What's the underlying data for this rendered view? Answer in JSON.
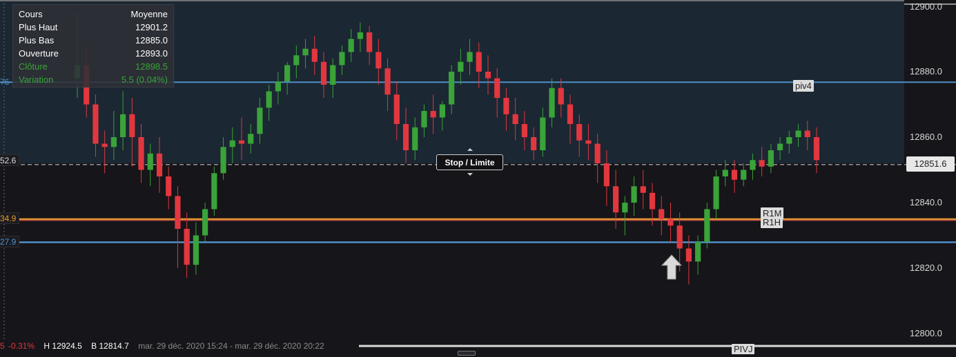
{
  "info_panel": {
    "header_left": "Cours",
    "header_right": "Moyenne",
    "rows": [
      {
        "label": "Plus Haut",
        "value": "12901.2"
      },
      {
        "label": "Plus Bas",
        "value": "12885.0"
      },
      {
        "label": "Ouverture",
        "value": "12893.0"
      },
      {
        "label": "Clôture",
        "value": "12898.5"
      },
      {
        "label": "Variation",
        "value": "5.5 (0.04%)"
      }
    ]
  },
  "left_tags": [
    {
      "text": "76",
      "color": "#4f90c8"
    },
    {
      "text": "52.6",
      "color": "#d8d8d8"
    },
    {
      "text": "34.9",
      "color": "#e49a2c"
    },
    {
      "text": "27.9",
      "color": "#4f90c8"
    }
  ],
  "price_axis": [
    "12900.0",
    "12880.0",
    "12860.0",
    "12851.6",
    "12840.0",
    "12820.0",
    "12800.0"
  ],
  "current_price": "12851.6",
  "levels": {
    "piv4": "piv4",
    "r1m": "R1M",
    "r1h": "R1H",
    "pivj": "PIVJ"
  },
  "stop_limit_label": "Stop / Limite",
  "bottom_bar": {
    "left_fragment": "5",
    "change": "-0.31%",
    "high": "H 12924.5",
    "low": "B 12814.7",
    "period": "mar. 29 déc. 2020 15:24 - mar. 29 déc. 2020 20:22"
  },
  "chart_data": {
    "type": "candlestick",
    "ylim": [
      12797,
      12902
    ],
    "y_ticks": [
      12800,
      12820,
      12840,
      12860,
      12880,
      12900
    ],
    "colors": {
      "up": "#3aa339",
      "down": "#e2373f",
      "background": "#161519",
      "zone": "#1b2733"
    },
    "horizontal_lines": [
      {
        "name": "piv4",
        "value": 12876.8,
        "color": "#4f90c8"
      },
      {
        "name": "current",
        "value": 12851.6,
        "color": "#d8d8d8"
      },
      {
        "name": "R1M",
        "value": 12834.9,
        "color": "#e49a2c"
      },
      {
        "name": "R1H",
        "value": 12834.6,
        "color": "#c0504d"
      },
      {
        "name": "pivot",
        "value": 12827.9,
        "color": "#4f90c8"
      }
    ],
    "candles": [
      [
        12878,
        12898,
        12882,
        12872
      ],
      [
        12882,
        12888,
        12870,
        12866
      ],
      [
        12870,
        12873,
        12858,
        12854
      ],
      [
        12858,
        12862,
        12857,
        12849
      ],
      [
        12857,
        12868,
        12860,
        12853
      ],
      [
        12860,
        12874,
        12867,
        12856
      ],
      [
        12867,
        12872,
        12860,
        12851
      ],
      [
        12860,
        12864,
        12850,
        12846
      ],
      [
        12850,
        12858,
        12855,
        12845
      ],
      [
        12855,
        12860,
        12848,
        12843
      ],
      [
        12848,
        12851,
        12842,
        12838
      ],
      [
        12842,
        12845,
        12832,
        12820
      ],
      [
        12832,
        12837,
        12821,
        12817
      ],
      [
        12821,
        12834,
        12830,
        12818
      ],
      [
        12830,
        12840,
        12838,
        12828
      ],
      [
        12838,
        12851,
        12849,
        12836
      ],
      [
        12849,
        12860,
        12857,
        12847
      ],
      [
        12857,
        12863,
        12859,
        12852
      ],
      [
        12859,
        12866,
        12858,
        12853
      ],
      [
        12858,
        12864,
        12861,
        12855
      ],
      [
        12861,
        12872,
        12869,
        12858
      ],
      [
        12869,
        12876,
        12874,
        12865
      ],
      [
        12874,
        12880,
        12877,
        12870
      ],
      [
        12877,
        12883,
        12882,
        12873
      ],
      [
        12882,
        12888,
        12885,
        12878
      ],
      [
        12885,
        12890,
        12887,
        12881
      ],
      [
        12887,
        12891,
        12883,
        12879
      ],
      [
        12883,
        12886,
        12876,
        12872
      ],
      [
        12876,
        12884,
        12882,
        12872
      ],
      [
        12882,
        12888,
        12886,
        12879
      ],
      [
        12886,
        12893,
        12890,
        12883
      ],
      [
        12890,
        12895,
        12892,
        12886
      ],
      [
        12892,
        12894,
        12886,
        12882
      ],
      [
        12886,
        12890,
        12881,
        12876
      ],
      [
        12881,
        12884,
        12873,
        12868
      ],
      [
        12873,
        12877,
        12864,
        12859
      ],
      [
        12864,
        12869,
        12856,
        12852
      ],
      [
        12856,
        12866,
        12863,
        12853
      ],
      [
        12863,
        12870,
        12868,
        12860
      ],
      [
        12868,
        12873,
        12866,
        12861
      ],
      [
        12866,
        12871,
        12870,
        12862
      ],
      [
        12870,
        12882,
        12880,
        12867
      ],
      [
        12880,
        12887,
        12883,
        12876
      ],
      [
        12883,
        12890,
        12886,
        12879
      ],
      [
        12886,
        12889,
        12880,
        12875
      ],
      [
        12880,
        12885,
        12878,
        12873
      ],
      [
        12878,
        12881,
        12872,
        12866
      ],
      [
        12872,
        12875,
        12867,
        12862
      ],
      [
        12867,
        12872,
        12864,
        12859
      ],
      [
        12864,
        12868,
        12860,
        12856
      ],
      [
        12860,
        12863,
        12856,
        12853
      ],
      [
        12856,
        12869,
        12866,
        12854
      ],
      [
        12866,
        12878,
        12875,
        12863
      ],
      [
        12875,
        12878,
        12870,
        12866
      ],
      [
        12870,
        12873,
        12864,
        12858
      ],
      [
        12864,
        12867,
        12859,
        12854
      ],
      [
        12859,
        12864,
        12858,
        12853
      ],
      [
        12858,
        12861,
        12852,
        12846
      ],
      [
        12852,
        12856,
        12845,
        12839
      ],
      [
        12845,
        12850,
        12837,
        12832
      ],
      [
        12837,
        12842,
        12840,
        12830
      ],
      [
        12840,
        12848,
        12845,
        12836
      ],
      [
        12845,
        12850,
        12843,
        12838
      ],
      [
        12843,
        12846,
        12838,
        12833
      ],
      [
        12838,
        12842,
        12835,
        12830
      ],
      [
        12835,
        12840,
        12833,
        12828
      ],
      [
        12833,
        12837,
        12826,
        12819
      ],
      [
        12826,
        12830,
        12822,
        12815
      ],
      [
        12822,
        12830,
        12828,
        12818
      ],
      [
        12828,
        12840,
        12838,
        12826
      ],
      [
        12838,
        12850,
        12848,
        12835
      ],
      [
        12848,
        12853,
        12850,
        12845
      ],
      [
        12850,
        12853,
        12847,
        12843
      ],
      [
        12847,
        12852,
        12850,
        12845
      ],
      [
        12850,
        12855,
        12853,
        12847
      ],
      [
        12853,
        12857,
        12851,
        12848
      ],
      [
        12851,
        12858,
        12856,
        12849
      ],
      [
        12856,
        12860,
        12858,
        12853
      ],
      [
        12858,
        12862,
        12860,
        12855
      ],
      [
        12860,
        12864,
        12862,
        12857
      ],
      [
        12862,
        12865,
        12860,
        12856
      ],
      [
        12860,
        12863,
        12853,
        12849
      ]
    ]
  },
  "icons": {
    "arrow": "up-arrow-icon",
    "handle": "drag-handle-icon"
  }
}
